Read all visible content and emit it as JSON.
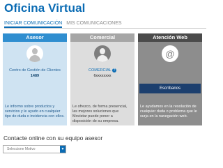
{
  "header": {
    "title": "Oficina Virtual"
  },
  "tabs": [
    {
      "label": "INICIAR COMUNICACIÓN",
      "active": true
    },
    {
      "label": "MIS COMUNICACIONES",
      "active": false
    }
  ],
  "cards": {
    "asesor": {
      "title": "Asesor",
      "center_name": "Centro de Gestión de Clientes",
      "number": "1489",
      "description": "Le informo sobre productos y servicios y le ayudo en cualquier tipo de duda o incidencia con ellos."
    },
    "comercial": {
      "title": "Comercial",
      "role": "COMERCIAL",
      "number": "6xxxxxxxx",
      "description": "Le ofrezco, de forma presencial, las mejores soluciones que Movistar puede poner a disposición de su empresa."
    },
    "web": {
      "title": "Atención Web",
      "button_label": "Escríbanos",
      "description": "Le ayudamos en la resolución de cualquier duda o problema que le surja en la navegación web."
    }
  },
  "contact": {
    "title": "Contacte online con su equipo asesor",
    "select_value": "Seleccione Motivo"
  },
  "icons": {
    "avatar": "user-avatar-icon",
    "web": "at-sign-icon",
    "help": "question-icon",
    "dropdown": "chevron-down-icon"
  },
  "colors": {
    "brand": "#0b6cb4",
    "asesor_header": "#2f8ed0",
    "comercial_header": "#a6a6a6",
    "web_header": "#4b4b4b",
    "button": "#1c3f6e"
  }
}
